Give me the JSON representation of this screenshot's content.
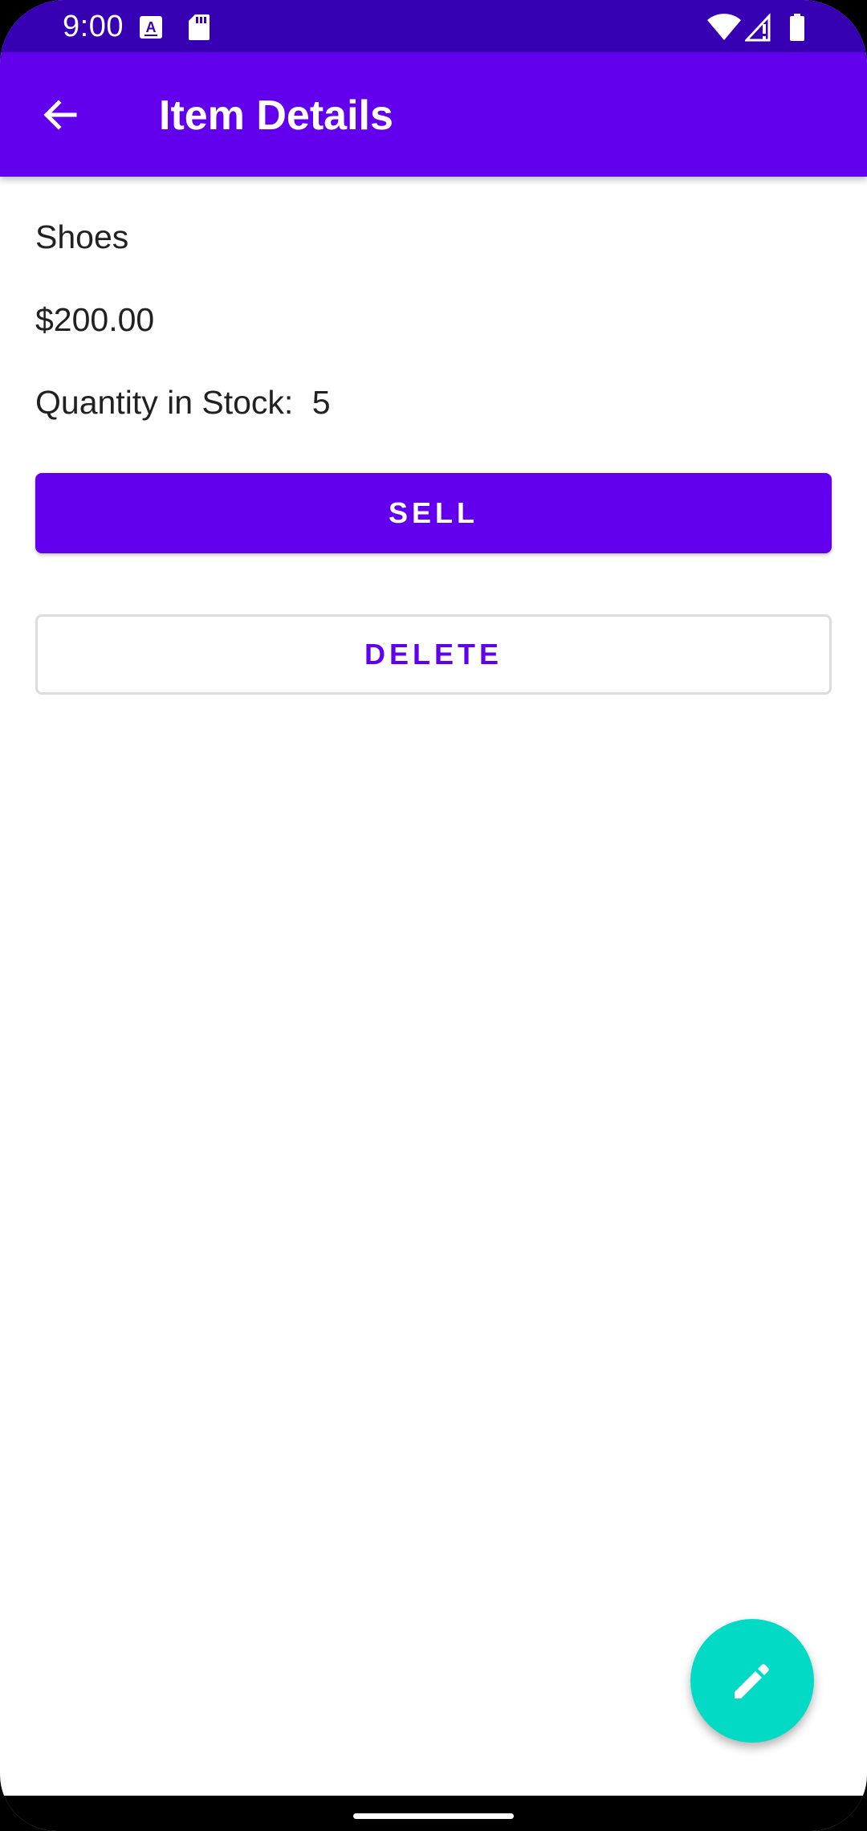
{
  "status_bar": {
    "time": "9:00",
    "icons": [
      "keyboard-a-icon",
      "sd-card-icon",
      "wifi-icon",
      "cell-signal-icon",
      "battery-icon"
    ]
  },
  "app_bar": {
    "title": "Item Details",
    "back_icon": "arrow-back-icon"
  },
  "item": {
    "name": "Shoes",
    "price": "$200.00",
    "quantity_label": "Quantity in Stock:",
    "quantity_value": "5"
  },
  "actions": {
    "sell_label": "SELL",
    "delete_label": "DELETE"
  },
  "fab": {
    "icon": "edit-pencil-icon"
  },
  "colors": {
    "status_bar": "#3700b3",
    "primary": "#6200ee",
    "fab": "#03dac5",
    "text": "#212121"
  }
}
